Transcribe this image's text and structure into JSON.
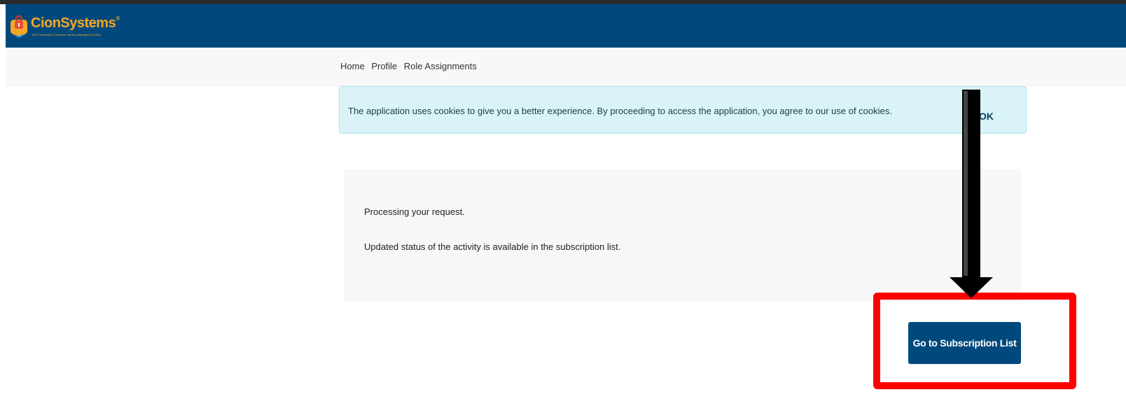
{
  "header": {
    "brand_name": "CionSystems",
    "brand_tm": "®",
    "brand_tagline": "Next Generation Enterprise Identity Management (EIM)"
  },
  "nav": {
    "items": [
      {
        "label": "Home"
      },
      {
        "label": "Profile"
      },
      {
        "label": "Role Assignments"
      }
    ]
  },
  "cookie_banner": {
    "message": "The application uses cookies to give you a better experience. By proceeding to access the application, you agree to our use of cookies.",
    "ok_label": "OK"
  },
  "status": {
    "line1": "Processing your request.",
    "line2": "Updated status of the activity is available in the subscription list."
  },
  "actions": {
    "subscription_button": "Go to Subscription List"
  },
  "colors": {
    "header_bg": "#01497c",
    "brand_orange": "#f5a623",
    "banner_bg": "#d9f3f8",
    "highlight": "#ff0000",
    "arrow": "#000000"
  }
}
